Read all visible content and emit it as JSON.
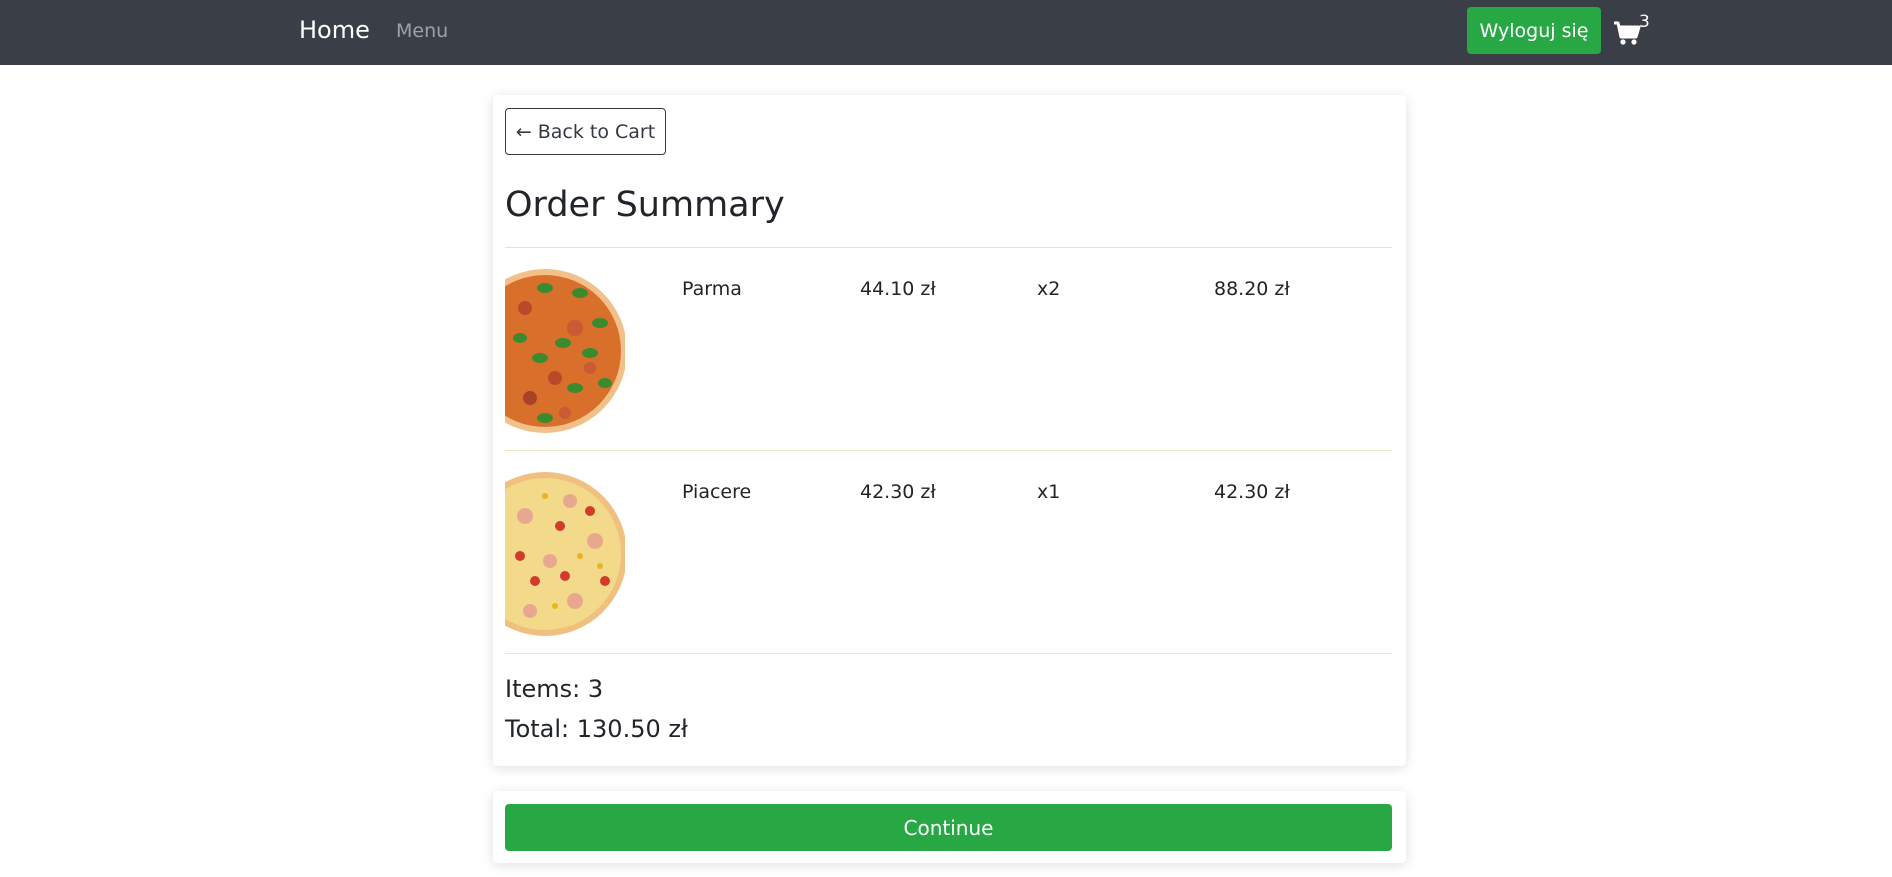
{
  "navbar": {
    "home_label": "Home",
    "menu_label": "Menu",
    "logout_label": "Wyloguj się",
    "cart_icon": "shopping-cart-icon",
    "cart_count": "3"
  },
  "summary": {
    "back_label": "← Back to Cart",
    "title": "Order Summary",
    "rows": [
      {
        "image_icon": "pizza-parma-image",
        "name": "Parma",
        "price": "44.10 zł",
        "qty": "x2",
        "total": "88.20 zł"
      },
      {
        "image_icon": "pizza-piacere-image",
        "name": "Piacere",
        "price": "42.30 zł",
        "qty": "x1",
        "total": "42.30 zł"
      }
    ],
    "items_text": "Items: 3",
    "total_text": "Total: 130.50 zł"
  },
  "actions": {
    "continue_label": "Continue"
  },
  "colors": {
    "navbar": "#3a3f47",
    "accent_green": "#28a745",
    "text": "#212529"
  }
}
